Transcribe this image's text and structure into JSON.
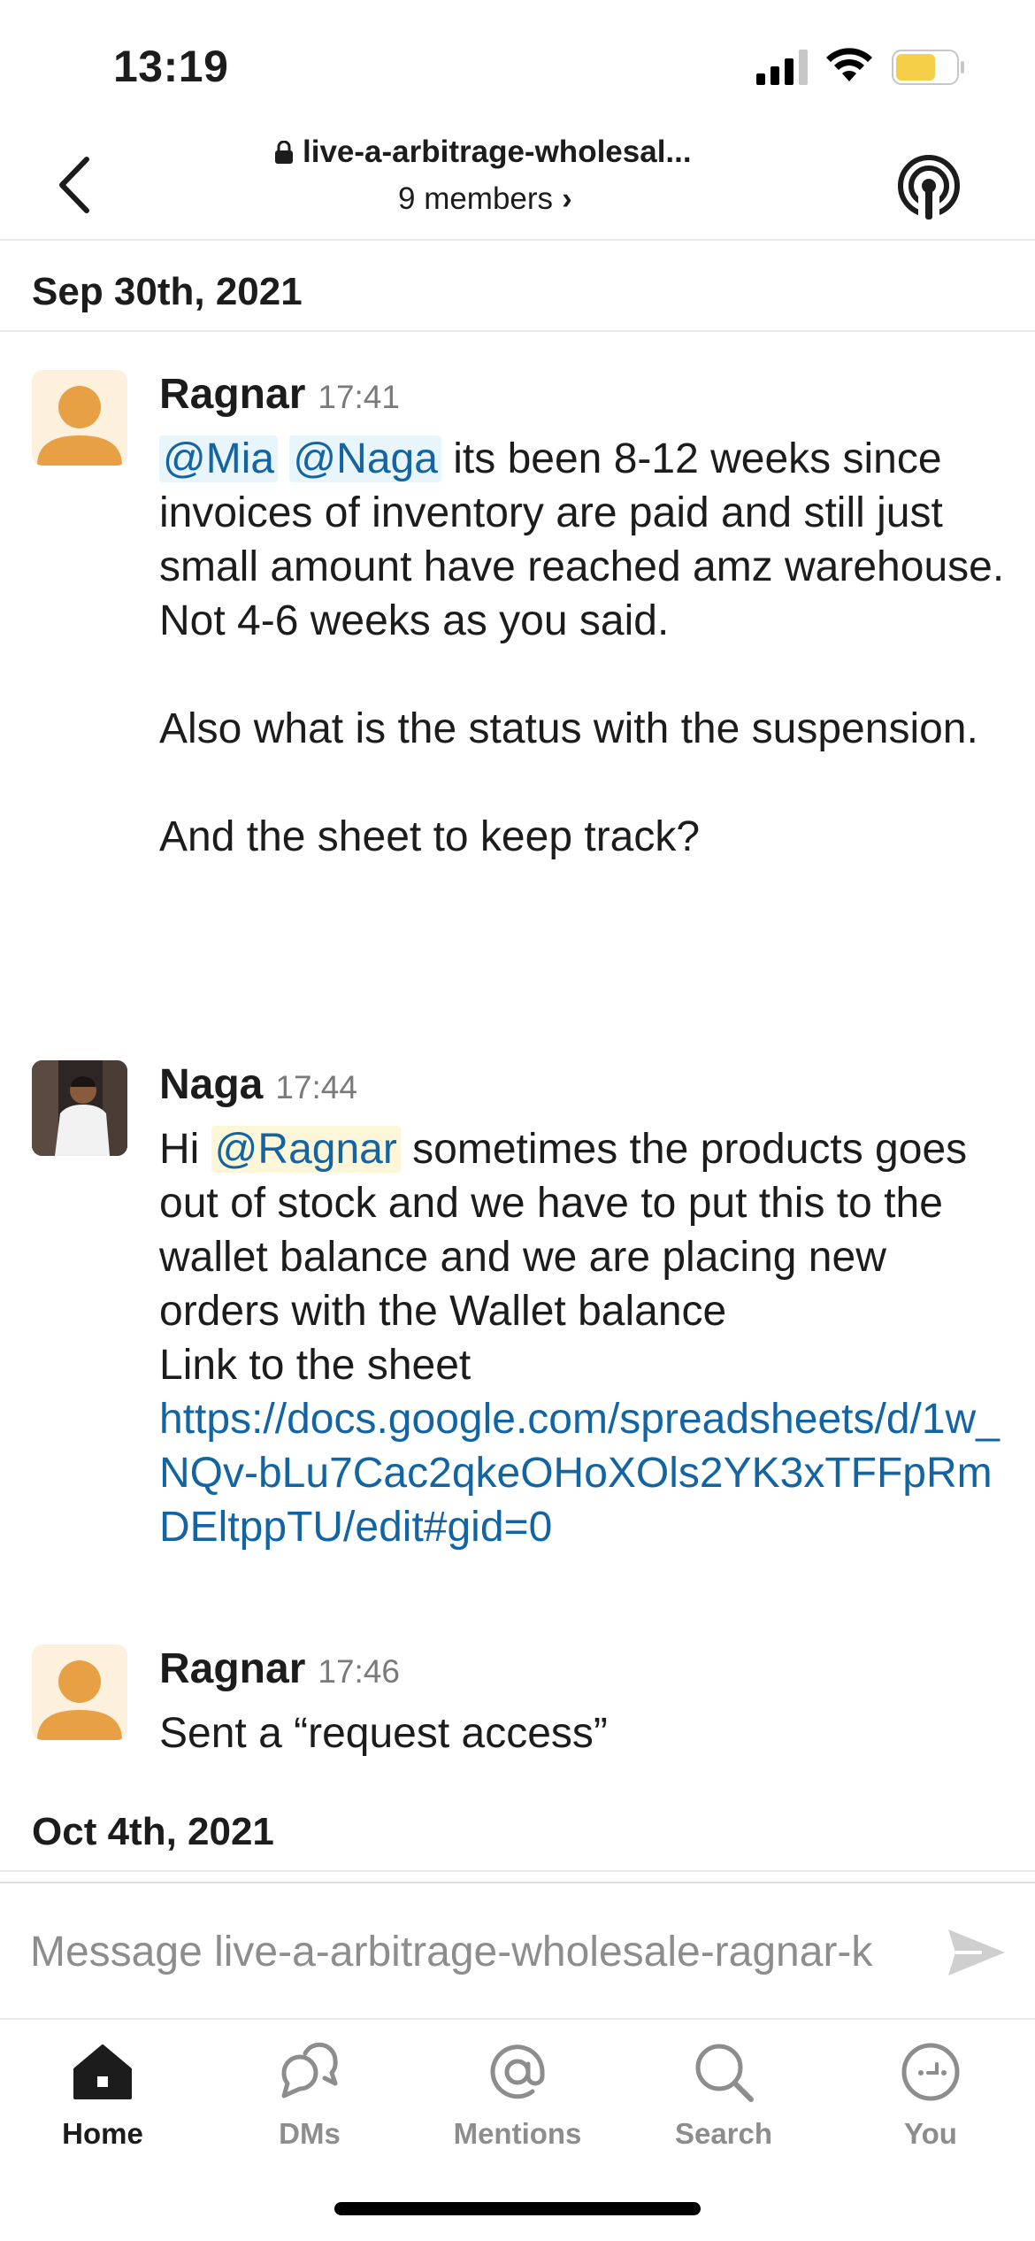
{
  "status_bar": {
    "time": "13:19"
  },
  "header": {
    "channel_name": "live-a-arbitrage-wholesal...",
    "members_label": "9 members",
    "members_chevron": "›"
  },
  "dates": [
    "Sep 30th, 2021",
    "Oct 4th, 2021"
  ],
  "messages": [
    {
      "author": "Ragnar",
      "time": "17:41",
      "mention1": "@Mia",
      "mention2": "@Naga",
      "text_a": " its been 8-12 weeks since invoices of inventory are paid and still just small amount have reached amz warehouse. Not 4-6 weeks as you said.",
      "text_b": "Also what is the status with the suspension.",
      "text_c": "And the sheet to keep track?"
    },
    {
      "author": "Naga",
      "time": "17:44",
      "prefix": "Hi ",
      "mention": "@Ragnar",
      "text_a": " sometimes the products goes out of stock and we have to put this to the wallet balance and we are placing new orders with the Wallet balance",
      "text_b": "Link to the sheet",
      "link": "https://docs.google.com/spreadsheets/d/1w_NQv-bLu7Cac2qkeOHoXOls2YK3xTFFpRmDEltppTU/edit#gid=0"
    },
    {
      "author": "Ragnar",
      "time": "17:46",
      "text": "Sent a “request access”"
    }
  ],
  "composer": {
    "placeholder": "Message live-a-arbitrage-wholesale-ragnar-k"
  },
  "tabs": [
    {
      "label": "Home"
    },
    {
      "label": "DMs"
    },
    {
      "label": "Mentions"
    },
    {
      "label": "Search"
    },
    {
      "label": "You"
    }
  ],
  "colors": {
    "accent": "#1264a3",
    "avatar_orange": "#e8a044",
    "battery": "#f5cf47"
  }
}
